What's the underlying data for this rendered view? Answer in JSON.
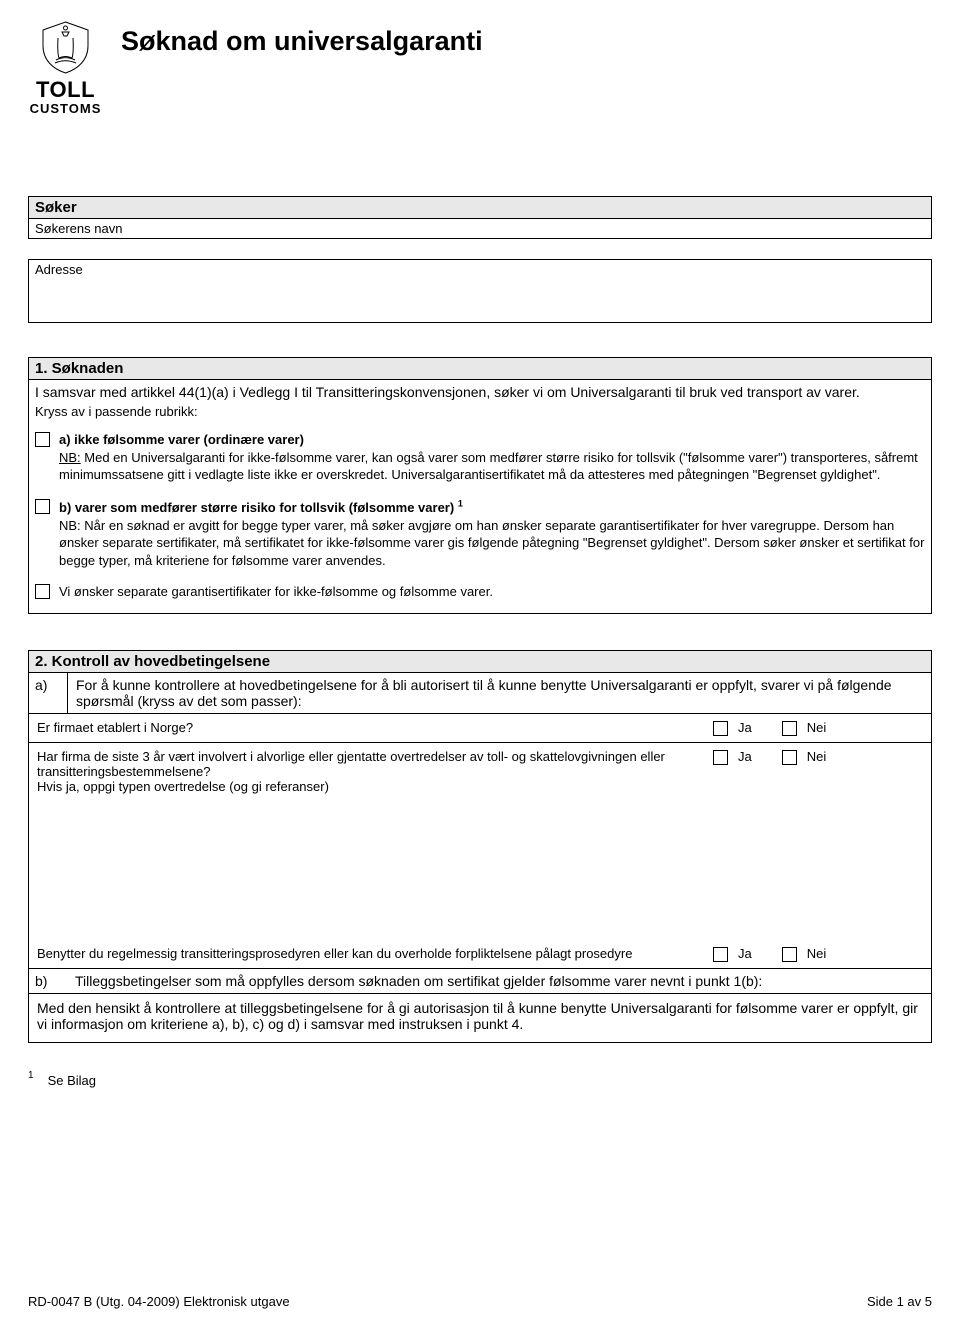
{
  "header": {
    "toll": "TOLL",
    "customs": "CUSTOMS",
    "title": "Søknad om universalgaranti"
  },
  "applicant": {
    "head": "Søker",
    "name_label": "Søkerens navn",
    "address_label": "Adresse"
  },
  "section1": {
    "head": "1. Søknaden",
    "intro": "I samsvar med artikkel 44(1)(a) i Vedlegg I til Transitteringskonvensjonen, søker vi om Universalgaranti til bruk ved transport av varer.",
    "kryss": "Kryss av i passende rubrikk:",
    "a_title": "a) ikke følsomme varer (ordinære varer)",
    "a_nb_label": "NB:",
    "a_body": " Med en Universalgaranti for ikke-følsomme varer, kan også varer som medfører større risiko for tollsvik (\"følsomme varer\") transporteres, såfremt minimumssatsene gitt i vedlagte liste ikke er overskredet. Universalgarantisertifikatet må da attesteres med påtegningen \"Begrenset gyldighet\".",
    "b_title": "b) varer som medfører større risiko for tollsvik (følsomme varer)",
    "b_sup": "1",
    "b_body": "NB: Når en søknad er avgitt for begge typer varer, må søker avgjøre om han ønsker separate garantisertifikater for hver varegruppe. Dersom han ønsker separate sertifikater, må sertifikatet for ikke-følsomme varer gis følgende påtegning \"Begrenset gyldighet\". Dersom søker ønsker et sertifikat for begge typer, må kriteriene for følsomme varer anvendes.",
    "c_text": "Vi ønsker separate garantisertifikater for ikke-følsomme og følsomme varer."
  },
  "section2": {
    "head": "2. Kontroll av hovedbetingelsene",
    "a_label": "a)",
    "a_text": "For å kunne kontrollere at hovedbetingelsene for å bli autorisert til å kunne benytte Universalgaranti er oppfylt, svarer vi på følgende spørsmål (kryss av det som passer):",
    "q1": "Er firmaet etablert i Norge?",
    "q2_line1": "Har firma de siste 3 år vært involvert i alvorlige eller gjentatte overtredelser av toll- og skattelovgivningen eller transitteringsbestemmelsene?",
    "q2_line2": "Hvis ja, oppgi typen overtredelse (og gi referanser)",
    "q3": "Benytter du regelmessig transitteringsprosedyren eller kan du overholde forpliktelsene pålagt prosedyre",
    "ja": "Ja",
    "nei": "Nei",
    "b_label": "b)",
    "b_text": "Tilleggsbetingelser som må oppfylles dersom søknaden om sertifikat gjelder følsomme varer nevnt i punkt 1(b):",
    "b_body": "Med den hensikt å kontrollere at tilleggsbetingelsene for å gi autorisasjon til å kunne benytte Universalgaranti for følsomme varer er oppfylt, gir vi informasjon om kriteriene a), b), c) og d) i samsvar med instruksen i punkt 4."
  },
  "footnote": {
    "sup": "1",
    "text": "Se Bilag"
  },
  "footer": {
    "left": "RD-0047 B (Utg. 04-2009) Elektronisk utgave",
    "right": "Side 1 av 5"
  }
}
